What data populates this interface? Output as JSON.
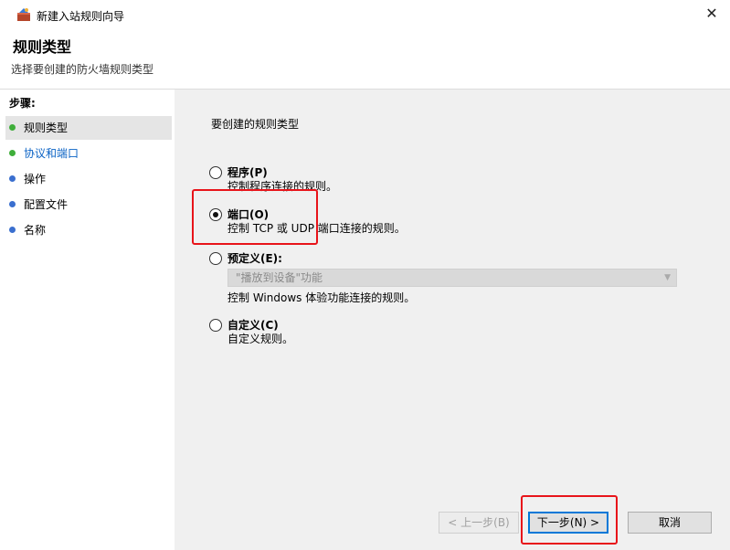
{
  "window": {
    "title": "新建入站规则向导",
    "close_glyph": "✕"
  },
  "header": {
    "title": "规则类型",
    "subtitle": "选择要创建的防火墙规则类型"
  },
  "steps": {
    "title": "步骤:",
    "items": [
      {
        "label": "规则类型",
        "state": "current"
      },
      {
        "label": "协议和端口",
        "state": "next"
      },
      {
        "label": "操作",
        "state": "pending"
      },
      {
        "label": "配置文件",
        "state": "pending"
      },
      {
        "label": "名称",
        "state": "pending"
      }
    ]
  },
  "content": {
    "prompt": "要创建的规则类型",
    "options": [
      {
        "label": "程序(P)",
        "desc": "控制程序连接的规则。",
        "selected": false
      },
      {
        "label": "端口(O)",
        "desc": "控制 TCP 或 UDP 端口连接的规则。",
        "selected": true
      },
      {
        "label": "预定义(E):",
        "desc": "控制 Windows 体验功能连接的规则。",
        "selected": false
      },
      {
        "label": "自定义(C)",
        "desc": "自定义规则。",
        "selected": false
      }
    ],
    "predefined_select": {
      "value": "\"播放到设备\"功能",
      "disabled": true
    }
  },
  "buttons": {
    "back": "< 上一步(B)",
    "next": "下一步(N) >",
    "cancel": "取消"
  },
  "colors": {
    "highlight": "#e8141a",
    "step_done": "#3fae3a",
    "step_pending": "#3a6fcf",
    "link": "#0b63c5"
  }
}
